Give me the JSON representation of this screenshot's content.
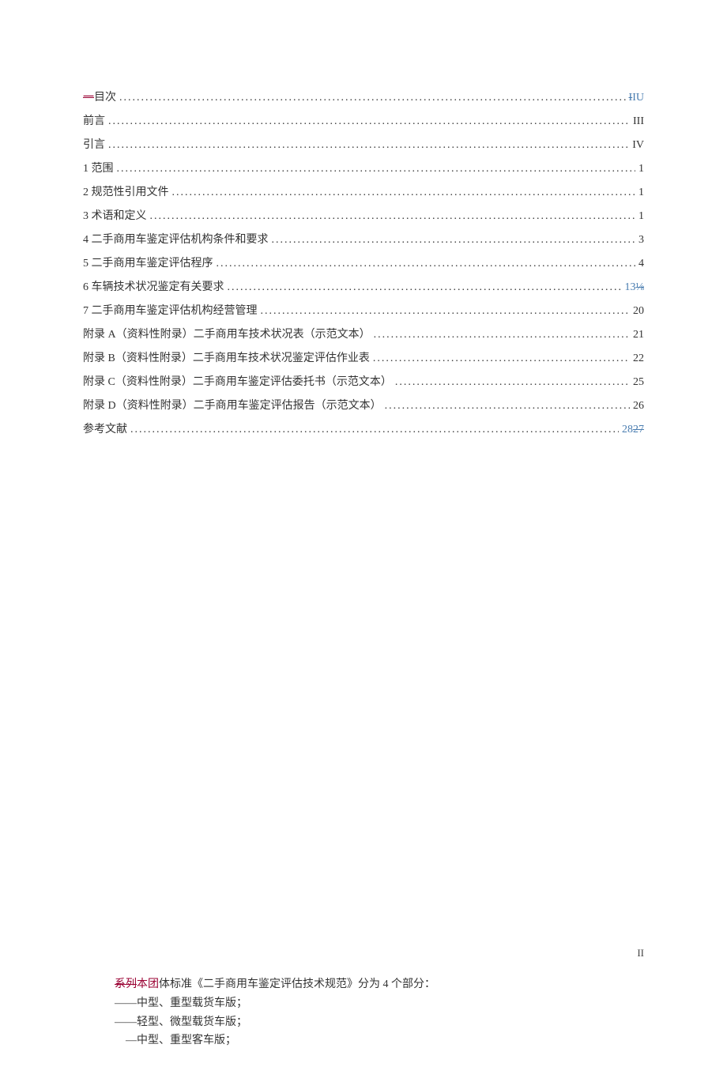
{
  "toc": [
    {
      "prefix_strike": "一",
      "label": "目次",
      "page_strike": "I",
      "page_suffix_blue": "IU",
      "special": true
    },
    {
      "label": "前言",
      "page": "III"
    },
    {
      "label": "引言",
      "page": "IV"
    },
    {
      "label": "1 范围",
      "page": "1"
    },
    {
      "label": "2 规范性引用文件",
      "page": "1"
    },
    {
      "label": "3 术语和定义",
      "page": "1"
    },
    {
      "label": "4 二手商用车鉴定评估机构条件和要求",
      "page": "3"
    },
    {
      "label": "5 二手商用车鉴定评估程序",
      "page": "4"
    },
    {
      "label": "6 车辆技术状况鉴定有关要求",
      "page_blue": "13",
      "page_strike_blue": "⅛"
    },
    {
      "label": "7 二手商用车鉴定评估机构经营管理",
      "page": "20"
    },
    {
      "label": "附录 A（资料性附录）二手商用车技术状况表（示范文本）",
      "page": "21"
    },
    {
      "label": "附录 B（资料性附录）二手商用车技术状况鉴定评估作业表",
      "page": "22"
    },
    {
      "label": "附录 C（资料性附录）二手商用车鉴定评估委托书（示范文本）",
      "page": "25"
    },
    {
      "label": "附录 D（资料性附录）二手商用车鉴定评估报告（示范文本）",
      "page": "26"
    },
    {
      "label": "参考文献",
      "page_blue": "28",
      "page_strike_blue": "27"
    }
  ],
  "page_marker": "II",
  "body": {
    "line1_strike": "系列",
    "line1_blue": "本团",
    "line1_rest": "体标准《二手商用车鉴定评估技术规范》分为 4 个部分：",
    "line2": "——中型、重型载货车版；",
    "line3": "——轻型、微型载货车版；",
    "line4": "　—中型、重型客车版；"
  }
}
